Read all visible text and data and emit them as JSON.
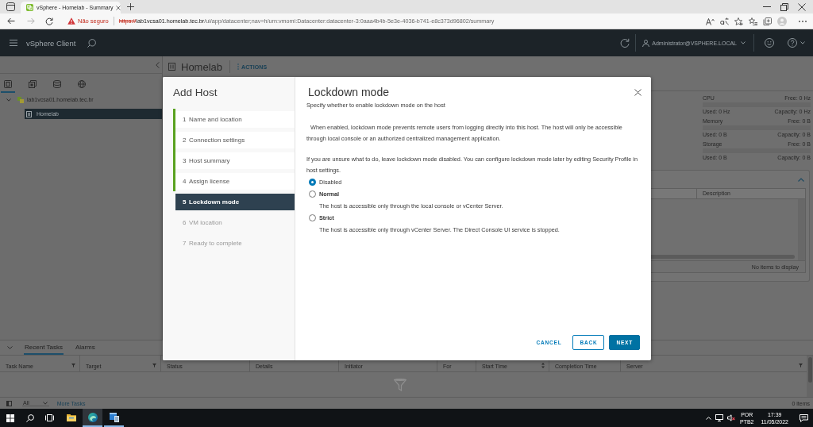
{
  "browser": {
    "tabs": [
      {
        "title": "vSphere - Homelab - Summary",
        "selected": true
      }
    ],
    "security_label": "Não seguro",
    "url": {
      "scheme": "https://",
      "host": "lab1vcsa01.homelab.tec.br",
      "path": "/ui/app/datacenter;nav=h/urn:vmomi:Datacenter:datacenter-3:0aaa4b4b-5e3e-4036-b741-e8c373d96802/summary"
    }
  },
  "header": {
    "app_name": "vSphere Client",
    "user": "Administrator@VSPHERE.LOCAL"
  },
  "navigator": {
    "views": [
      {
        "selected": true
      },
      {
        "selected": false
      },
      {
        "selected": false
      },
      {
        "selected": false
      }
    ],
    "tree": [
      {
        "label": "lab1vcsa01.homelab.tec.br",
        "expanded": true,
        "selected": false,
        "children": [
          {
            "label": "Homelab",
            "selected": true
          }
        ]
      }
    ]
  },
  "page": {
    "title": "Homelab",
    "actions": "ACTIONS",
    "resources": [
      {
        "name": "CPU",
        "free": "Free: 0 Hz",
        "used": "Used: 0 Hz",
        "capacity": "Capacity: 0 Hz"
      },
      {
        "name": "Memory",
        "free": "Free: 0 B",
        "used": "Used: 0 B",
        "capacity": "Capacity: 0 B"
      },
      {
        "name": "Storage",
        "free": "Free: 0 B",
        "used": "Used: 0 B",
        "capacity": "Capacity: 0 B"
      }
    ],
    "table": {
      "columns": [
        "Description"
      ],
      "empty_text": "No items to display"
    }
  },
  "dialog": {
    "title": "Add Host",
    "steps": [
      {
        "number": "1",
        "label": "Name and location",
        "completed": true,
        "selected": false,
        "disabled": false
      },
      {
        "number": "2",
        "label": "Connection settings",
        "completed": true,
        "selected": false,
        "disabled": false
      },
      {
        "number": "3",
        "label": "Host summary",
        "completed": true,
        "selected": false,
        "disabled": false
      },
      {
        "number": "4",
        "label": "Assign license",
        "completed": true,
        "selected": false,
        "disabled": false
      },
      {
        "number": "5",
        "label": "Lockdown mode",
        "completed": false,
        "selected": true,
        "disabled": false
      },
      {
        "number": "6",
        "label": "VM location",
        "completed": false,
        "selected": false,
        "disabled": true
      },
      {
        "number": "7",
        "label": "Ready to complete",
        "completed": false,
        "selected": false,
        "disabled": true
      }
    ],
    "page_title": "Lockdown mode",
    "subtitle": "Specify whether to enable lockdown mode on the host",
    "paragraphs": [
      "When enabled, lockdown mode prevents remote users from logging directly into this host. The host will only be accessible through local console or an authorized centralized management application.",
      "If you are unsure what to do, leave lockdown mode disabled. You can configure lockdown mode later by editing Security Profile in host settings."
    ],
    "options": [
      {
        "label": "Disabled",
        "selected": true
      },
      {
        "label": "Normal",
        "selected": false,
        "description": "The host is accessible only through the local console or vCenter Server."
      },
      {
        "label": "Strict",
        "selected": false,
        "description": "The host is accessible only through vCenter Server. The Direct Console UI service is stopped."
      }
    ],
    "buttons": [
      {
        "label": "CANCEL",
        "kind": "link"
      },
      {
        "label": "BACK",
        "kind": "outline"
      },
      {
        "label": "NEXT",
        "kind": "primary"
      }
    ]
  },
  "tasks": {
    "tabs": [
      {
        "label": "Recent Tasks",
        "selected": true
      },
      {
        "label": "Alarms",
        "selected": false
      }
    ],
    "columns": [
      {
        "label": "Task Name",
        "filter": true,
        "sort": false
      },
      {
        "label": "Target",
        "filter": true,
        "sort": false
      },
      {
        "label": "Status",
        "filter": false,
        "sort": false
      },
      {
        "label": "Details",
        "filter": false,
        "sort": false
      },
      {
        "label": "Initiator",
        "filter": false,
        "sort": false
      },
      {
        "label": "For",
        "filter": false,
        "sort": false
      },
      {
        "label": "Start Time",
        "filter": false,
        "sort": true
      },
      {
        "label": "Completion Time",
        "filter": false,
        "sort": false
      },
      {
        "label": "Server",
        "filter": true,
        "sort": false
      }
    ],
    "filter": "All",
    "more_link": "More Tasks",
    "count": "0 items"
  },
  "taskbar": {
    "apps": [
      {
        "running": false,
        "selected": false
      },
      {
        "running": true,
        "selected": true
      },
      {
        "running": true,
        "selected": false
      }
    ],
    "language": "POR",
    "layout": "PTB2",
    "time": "17:39",
    "date": "11/05/2022"
  }
}
